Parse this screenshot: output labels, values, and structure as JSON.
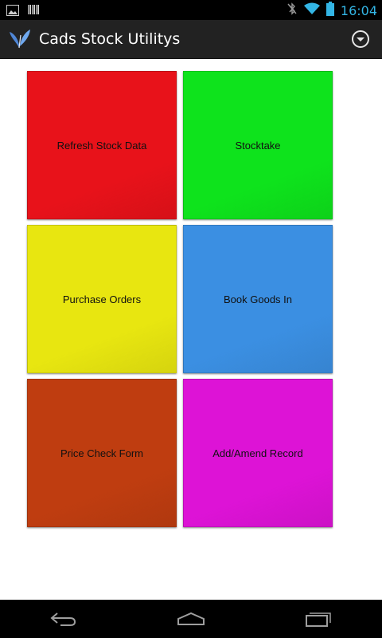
{
  "status_bar": {
    "time": "16:04",
    "icons": [
      "image-icon",
      "barcode-icon",
      "bluetooth-off-icon",
      "wifi-icon",
      "battery-icon"
    ]
  },
  "action_bar": {
    "title": "Cads Stock Utilitys",
    "icon": "butterfly-logo-icon",
    "overflow_icon": "chevron-down-circle-icon"
  },
  "tiles": [
    {
      "label": "Refresh Stock Data",
      "color": "#e8121a"
    },
    {
      "label": "Stocktake",
      "color": "#0ee31c"
    },
    {
      "label": "Purchase Orders",
      "color": "#e8e610"
    },
    {
      "label": "Book Goods In",
      "color": "#3b8fe2"
    },
    {
      "label": "Price Check Form",
      "color": "#bf3d10"
    },
    {
      "label": "Add/Amend Record",
      "color": "#dd13d6"
    }
  ],
  "nav_bar": {
    "icons": [
      "back-icon",
      "home-icon",
      "recent-apps-icon"
    ]
  }
}
